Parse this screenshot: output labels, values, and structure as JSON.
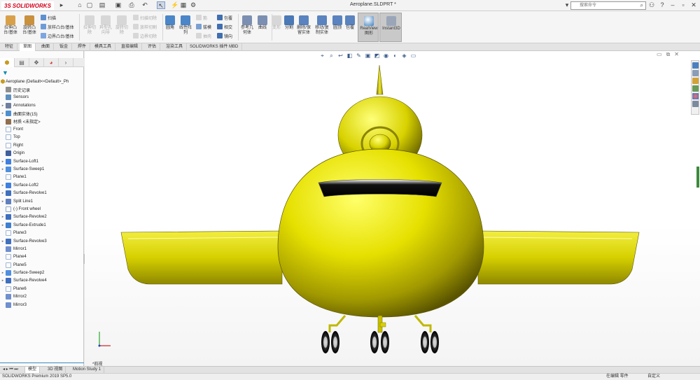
{
  "app": {
    "brand_ds": "3S",
    "brand_name": "SOLIDWORKS",
    "document_title": "Aeroplane.SLDPRT *",
    "search_placeholder": "搜索命令"
  },
  "ribbon": {
    "extruded_boss": "拉伸凸\n台/基体",
    "revolved_boss": "旋转凸\n台/基体",
    "sweep": "扫描",
    "loft": "放样凸台/基体",
    "boundary": "边界凸台/基体",
    "extruded_cut": "拉伸切\n除",
    "hole_wizard": "异型孔\n向导",
    "revolved_cut": "旋转切\n除",
    "swept_cut": "扫描切除",
    "lofted_cut": "放样切割",
    "boundary_cut": "边界切除",
    "fillet": "圆角",
    "linear_pattern": "线性阵\n列",
    "rib": "筋",
    "draft": "拔模",
    "shell": "抽壳",
    "wrap": "包覆",
    "intersect": "相交",
    "mirror": "镜向",
    "ref_geometry": "参考几\n何体",
    "curves": "曲线",
    "instant3d": "Instant3D",
    "realview": "RealView\n图形",
    "split": "分割",
    "combine": "组合",
    "move_copy": "移动/复\n制实体",
    "delete_body": "删除/保\n留实体",
    "dome": "圆顶",
    "indent": "包覆",
    "freeform": "变形"
  },
  "command_tabs": [
    "特征",
    "草图",
    "曲面",
    "钣金",
    "焊件",
    "模具工具",
    "直接编辑",
    "评估",
    "渲染工具",
    "SOLIDWORKS 插件",
    "MBD"
  ],
  "active_command_tab": "草图",
  "tree": {
    "root": "Aeroplane  (Default<<Default>_Ph",
    "items": [
      {
        "label": "历史记录",
        "icon": "history",
        "arrow": ""
      },
      {
        "label": "Sensors",
        "icon": "sensor",
        "arrow": ""
      },
      {
        "label": "Annotations",
        "icon": "annotation",
        "arrow": "▸"
      },
      {
        "label": "曲面实体(15)",
        "icon": "surface-bodies",
        "arrow": "▸"
      },
      {
        "label": "材质 <未指定>",
        "icon": "material",
        "arrow": ""
      },
      {
        "label": "Front",
        "icon": "plane",
        "arrow": ""
      },
      {
        "label": "Top",
        "icon": "plane",
        "arrow": ""
      },
      {
        "label": "Right",
        "icon": "plane",
        "arrow": ""
      },
      {
        "label": "Origin",
        "icon": "origin",
        "arrow": ""
      },
      {
        "label": "Surface-Loft1",
        "icon": "loft",
        "arrow": "▸"
      },
      {
        "label": "Surface-Sweep1",
        "icon": "sweep",
        "arrow": "▸"
      },
      {
        "label": "Plane1",
        "icon": "plane",
        "arrow": ""
      },
      {
        "label": "Surface-Loft2",
        "icon": "loft",
        "arrow": "▸"
      },
      {
        "label": "Surface-Revolve1",
        "icon": "revolve",
        "arrow": "▸"
      },
      {
        "label": "Split Line1",
        "icon": "split",
        "arrow": "▸"
      },
      {
        "label": "(-) Front wheel",
        "icon": "sketch",
        "arrow": ""
      },
      {
        "label": "Surface-Revolve2",
        "icon": "revolve",
        "arrow": "▸"
      },
      {
        "label": "Surface-Extrude1",
        "icon": "extrude",
        "arrow": "▸"
      },
      {
        "label": "Plane3",
        "icon": "plane",
        "arrow": ""
      },
      {
        "label": "Surface-Revolve3",
        "icon": "revolve",
        "arrow": "▸"
      },
      {
        "label": "Mirror1",
        "icon": "mirror",
        "arrow": ""
      },
      {
        "label": "Plane4",
        "icon": "plane",
        "arrow": ""
      },
      {
        "label": "Plane5",
        "icon": "plane",
        "arrow": ""
      },
      {
        "label": "Surface-Sweep2",
        "icon": "sweep",
        "arrow": "▸"
      },
      {
        "label": "Surface-Revolve4",
        "icon": "revolve",
        "arrow": "▸"
      },
      {
        "label": "Plane6",
        "icon": "plane",
        "arrow": ""
      },
      {
        "label": "Mirror2",
        "icon": "mirror",
        "arrow": ""
      },
      {
        "label": "Mirror3",
        "icon": "mirror",
        "arrow": ""
      }
    ]
  },
  "viewport": {
    "view_label": "*前视"
  },
  "bottom_tabs": [
    "模型",
    "3D 视图",
    "Motion Study 1"
  ],
  "active_bottom_tab": "模型",
  "status": {
    "product": "SOLIDWORKS Premium 2019 SP5.0",
    "mode": "在编辑 零件",
    "units": "自定义"
  },
  "colors": {
    "aircraft_yellow": "#e8e000",
    "accent_blue": "#1d74c9",
    "brand_red": "#d0021b"
  }
}
